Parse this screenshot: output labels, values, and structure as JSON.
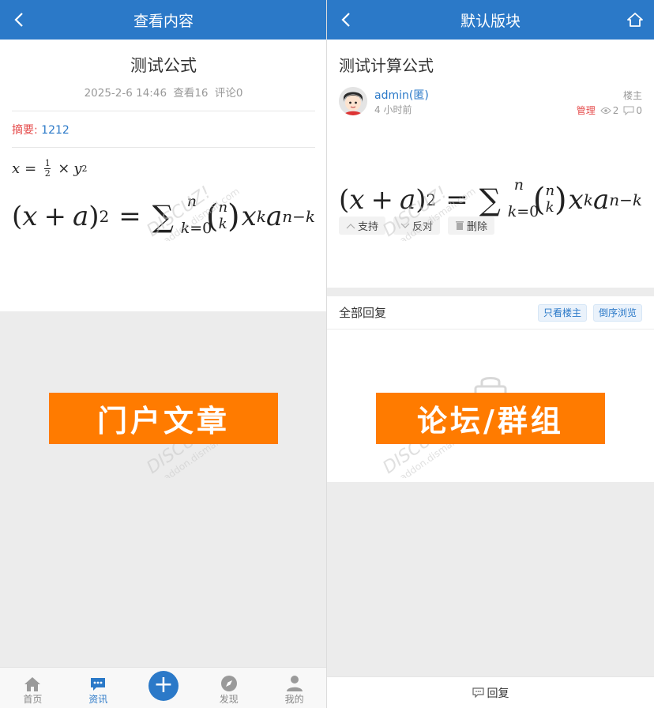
{
  "left": {
    "navbar": {
      "title": "查看内容",
      "back_icon": "chevron-left-icon"
    },
    "article": {
      "title": "测试公式",
      "date": "2025-2-6 14:46",
      "views": "查看16",
      "comments": "评论0",
      "summary_label": "摘要:",
      "summary_value": "1212"
    },
    "banner": "门户文章",
    "tabbar": [
      {
        "label": "首页",
        "icon": "home-icon"
      },
      {
        "label": "资讯",
        "icon": "chat-dots-icon",
        "active": true
      },
      {
        "label": "",
        "icon": "plus-icon"
      },
      {
        "label": "发现",
        "icon": "compass-icon"
      },
      {
        "label": "我的",
        "icon": "user-icon"
      }
    ]
  },
  "right": {
    "navbar": {
      "title": "默认版块",
      "back_icon": "chevron-left-icon",
      "home_icon": "home-outline-icon"
    },
    "post": {
      "title": "测试计算公式",
      "author": "admin(匿)",
      "time": "4 小时前",
      "floor": "楼主",
      "manage": "管理",
      "views": "2",
      "replies": "0"
    },
    "actions": {
      "support": "支持",
      "oppose": "反对",
      "delete": "删除"
    },
    "reply_header": {
      "label": "全部回复",
      "only_author": "只看楼主",
      "reverse": "倒序浏览"
    },
    "banner": "论坛/群组",
    "reply_bar": "回复"
  },
  "colors": {
    "primary": "#2b79c8",
    "banner": "#ff7b00",
    "danger": "#e54c4c"
  }
}
